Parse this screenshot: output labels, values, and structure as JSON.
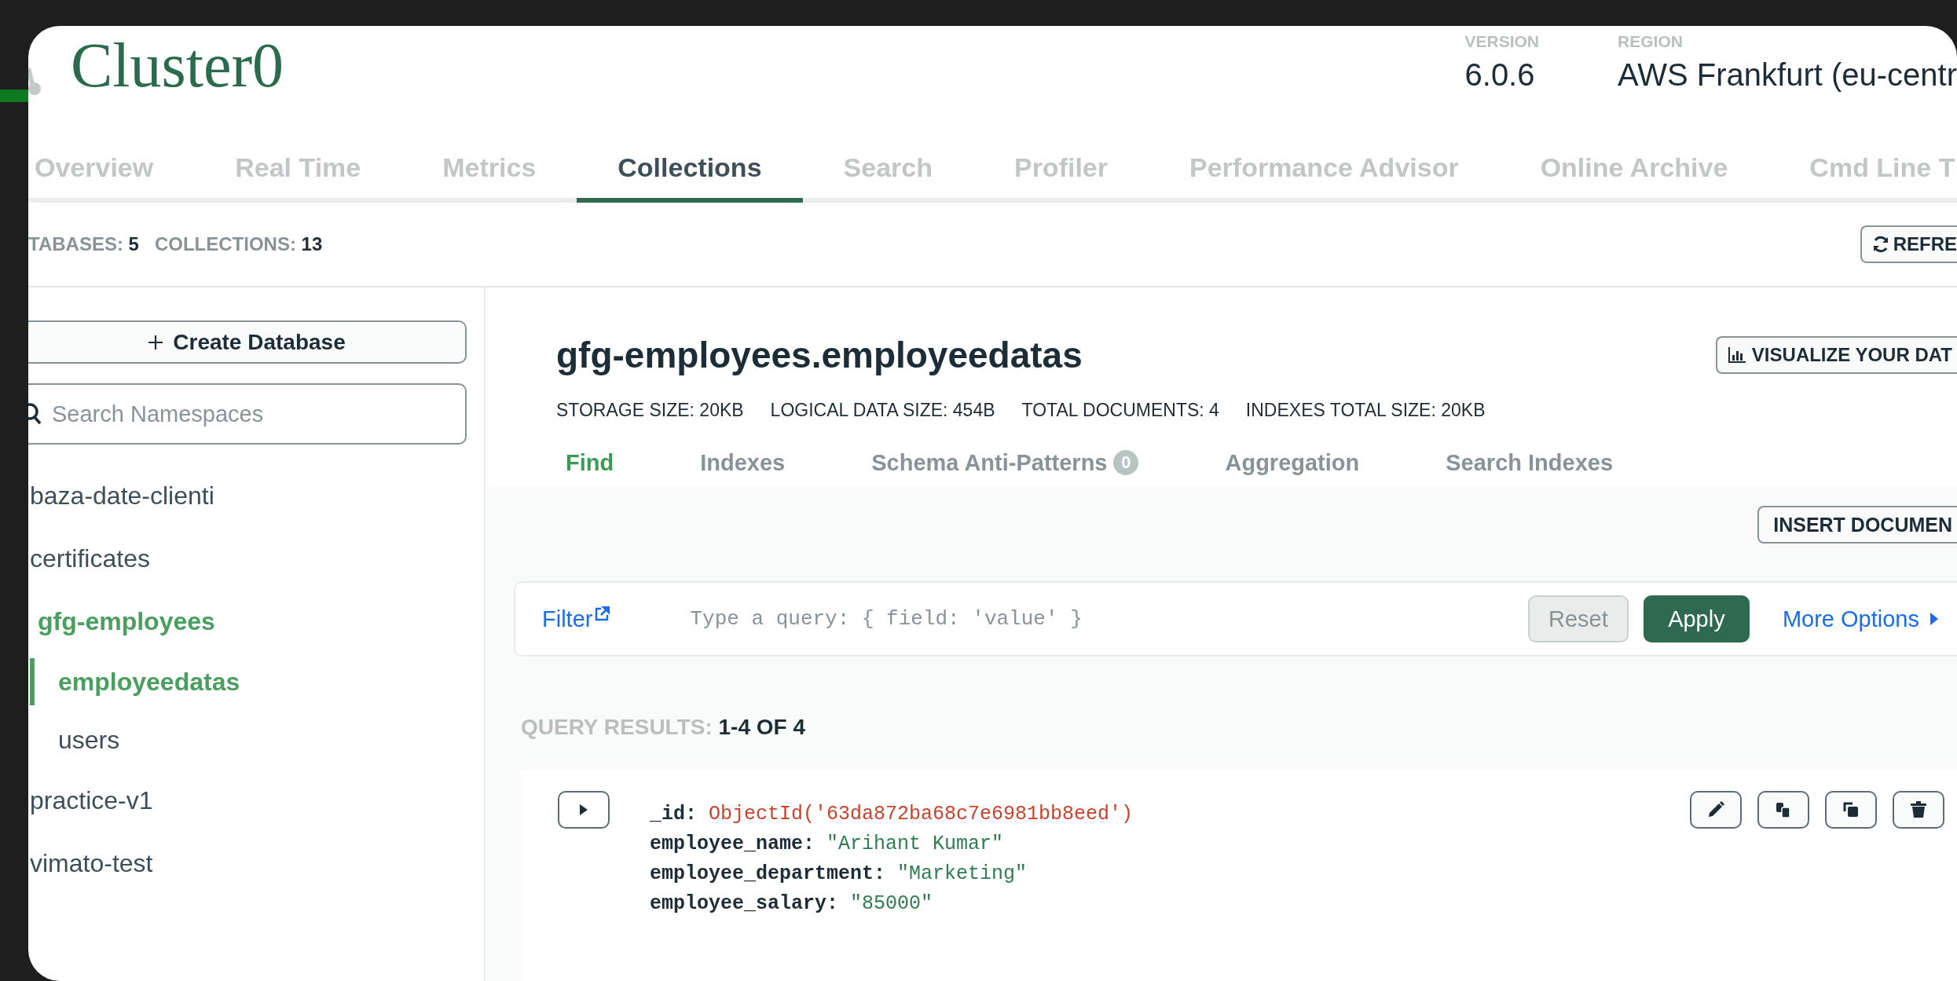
{
  "header": {
    "title": "Cluster0",
    "version_label": "VERSION",
    "version": "6.0.6",
    "region_label": "REGION",
    "region": "AWS Frankfurt (eu-centr"
  },
  "tabs": [
    {
      "label": "Overview",
      "selected": false
    },
    {
      "label": "Real Time",
      "selected": false
    },
    {
      "label": "Metrics",
      "selected": false
    },
    {
      "label": "Collections",
      "selected": true
    },
    {
      "label": "Search",
      "selected": false
    },
    {
      "label": "Profiler",
      "selected": false
    },
    {
      "label": "Performance Advisor",
      "selected": false
    },
    {
      "label": "Online Archive",
      "selected": false
    },
    {
      "label": "Cmd Line T",
      "selected": false
    }
  ],
  "stats": [
    {
      "label": "TABASES:",
      "value": "5"
    },
    {
      "label": "COLLECTIONS:",
      "value": "13"
    }
  ],
  "refresh_button": "REFRE",
  "sidebar": {
    "create_button": "Create Database",
    "search": {
      "placeholder": "Search Namespaces"
    },
    "databases": [
      {
        "name": "baza-date-clienti",
        "selected": false
      },
      {
        "name": "certificates",
        "selected": false
      },
      {
        "name": "gfg-employees",
        "selected": true,
        "children": [
          {
            "name": "employeedatas",
            "selected": true
          },
          {
            "name": "users",
            "selected": false
          }
        ]
      },
      {
        "name": "practice-v1",
        "selected": false
      },
      {
        "name": "vimato-test",
        "selected": false
      }
    ]
  },
  "collection": {
    "title": "gfg-employees.employeedatas",
    "visualize_button": "VISUALIZE YOUR DAT",
    "stats": [
      {
        "label": "STORAGE SIZE:",
        "value": "20KB"
      },
      {
        "label": "LOGICAL DATA SIZE:",
        "value": "454B"
      },
      {
        "label": "TOTAL DOCUMENTS:",
        "value": "4"
      },
      {
        "label": "INDEXES TOTAL SIZE:",
        "value": "20KB"
      }
    ],
    "subtabs": [
      {
        "label": "Find",
        "selected": true
      },
      {
        "label": "Indexes",
        "selected": false
      },
      {
        "label": "Schema Anti-Patterns",
        "selected": false,
        "badge": "0"
      },
      {
        "label": "Aggregation",
        "selected": false
      },
      {
        "label": "Search Indexes",
        "selected": false
      }
    ],
    "insert_button": "INSERT DOCUMEN",
    "filter": {
      "label": "Filter",
      "placeholder": "Type a query: { field: 'value' }",
      "reset": {
        "label": "Reset",
        "disabled": true
      },
      "apply": "Apply",
      "more": "More Options"
    },
    "results_label": "QUERY RESULTS:",
    "results_value": "1-4 OF 4",
    "documents": [
      {
        "fields": [
          {
            "key": "_id:",
            "value": "ObjectId('63da872ba68c7e6981bb8eed')",
            "kind": "objectid"
          },
          {
            "key": "employee_name:",
            "value": "\"Arihant Kumar\"",
            "kind": "string"
          },
          {
            "key": "employee_department:",
            "value": "\"Marketing\"",
            "kind": "string"
          },
          {
            "key": "employee_salary:",
            "value": "\"85000\"",
            "kind": "string"
          }
        ]
      }
    ]
  }
}
